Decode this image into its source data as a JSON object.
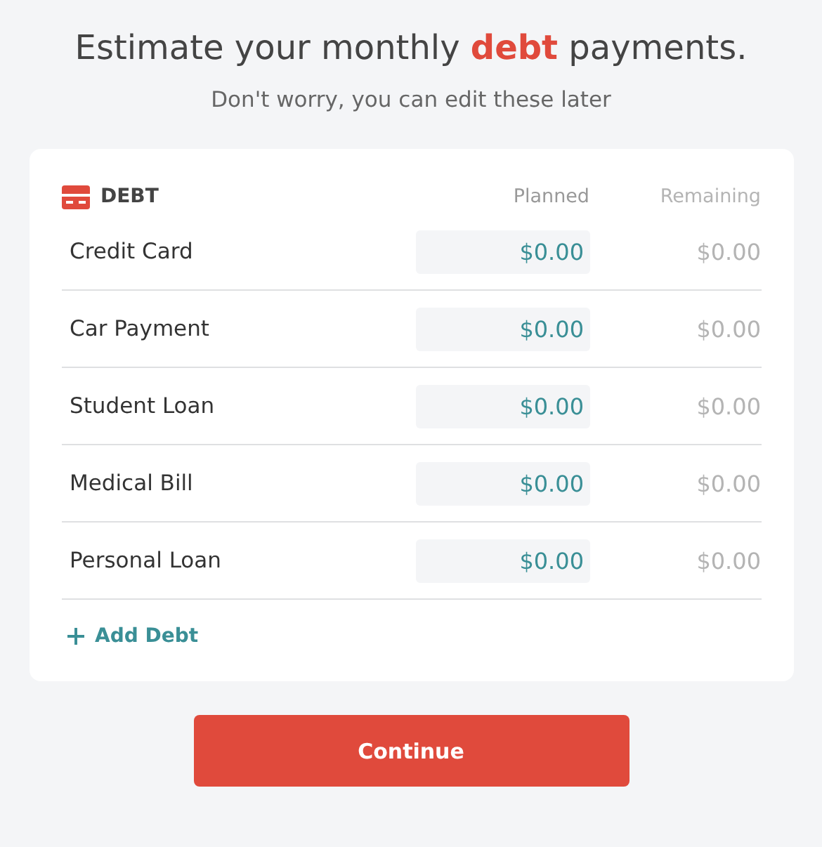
{
  "heading": "Estimate your monthly **debt** payments.",
  "subheading": "Don't worry, you can edit these later",
  "section": {
    "title": "DEBT",
    "columns": [
      "Planned",
      "Remaining"
    ]
  },
  "rows": [
    {
      "name": "Credit Card",
      "planned": "$0.00",
      "remaining": "$0.00"
    },
    {
      "name": "Car Payment",
      "planned": "$0.00",
      "remaining": "$0.00"
    },
    {
      "name": "Student Loan",
      "planned": "$0.00",
      "remaining": "$0.00"
    },
    {
      "name": "Medical Bill",
      "planned": "$0.00",
      "remaining": "$0.00"
    },
    {
      "name": "Personal Loan",
      "planned": "$0.00",
      "remaining": "$0.00"
    }
  ],
  "add_link": "Add Debt",
  "button": "Continue"
}
